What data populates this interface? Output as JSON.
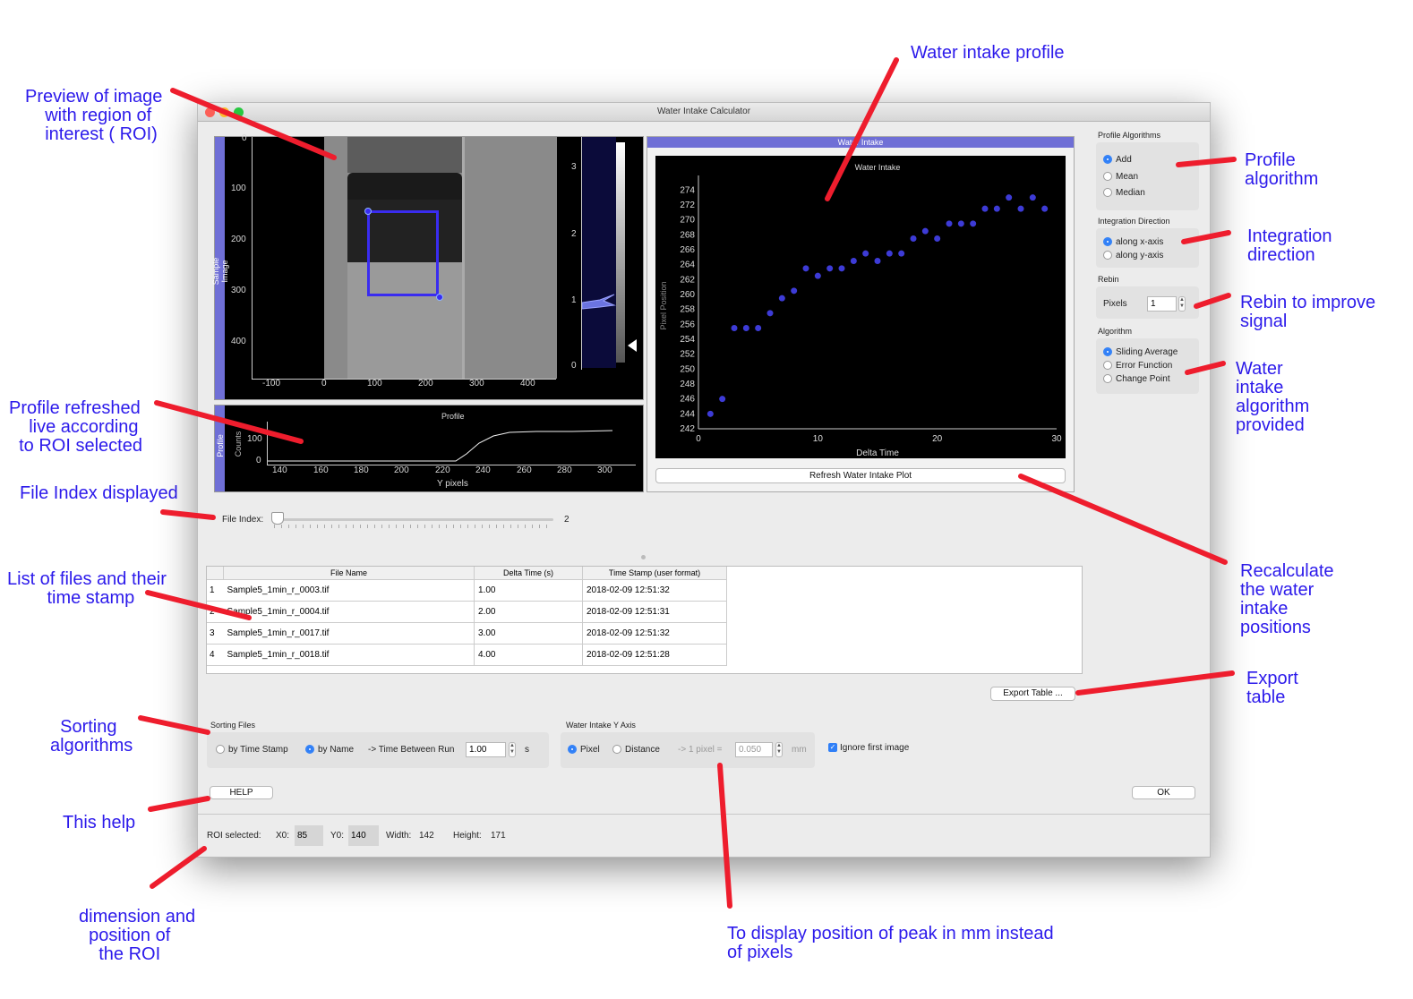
{
  "window": {
    "title": "Water Intake Calculator"
  },
  "annotations": {
    "preview": "Preview of image\n    with region of\n    interest ( ROI)",
    "profile_refreshed": "Profile refreshed\n    live according\n  to ROI selected",
    "file_index": "File Index displayed",
    "list_files": "List of files and their\n        time stamp",
    "sorting": "  Sorting\nalgorithms",
    "this_help": "This help",
    "dimension": "dimension and\n  position of\n    the ROI",
    "water_profile": "Water intake profile",
    "profile_algorithm": "Profile\nalgorithm",
    "integration_direction": "Integration\ndirection",
    "rebin": "Rebin to improve\nsignal",
    "water_algo": "Water\nintake\nalgorithm\nprovided",
    "recalculate": "Recalculate\nthe water\nintake\npositions",
    "export": "Export\ntable",
    "display_mm": "To display position of peak in mm instead\nof pixels"
  },
  "image_preview": {
    "side_label": "Sample Image",
    "y_ticks": [
      "0",
      "100",
      "200",
      "300",
      "400"
    ],
    "x_ticks": [
      "-100",
      "0",
      "100",
      "200",
      "300",
      "400"
    ],
    "hist_ticks": [
      "3",
      "2",
      "1",
      "0"
    ]
  },
  "profile_plot": {
    "side_label": "Profile",
    "title": "Profile",
    "ylabel": "Counts",
    "xlabel": "Y pixels",
    "y_ticks": [
      "100",
      "0"
    ],
    "x_ticks": [
      "140",
      "160",
      "180",
      "200",
      "220",
      "240",
      "260",
      "280",
      "300"
    ]
  },
  "water_intake_panel": {
    "header": "Water Intake",
    "refresh_button": "Refresh Water Intake Plot"
  },
  "chart_data": {
    "type": "scatter",
    "title": "Water Intake",
    "xlabel": "Delta Time",
    "ylabel": "Pixel Position",
    "xlim": [
      0,
      30
    ],
    "ylim": [
      242,
      275
    ],
    "x_ticks": [
      "0",
      "10",
      "20",
      "30"
    ],
    "y_ticks": [
      "242",
      "244",
      "246",
      "248",
      "250",
      "252",
      "254",
      "256",
      "258",
      "260",
      "262",
      "264",
      "266",
      "268",
      "270",
      "272",
      "274"
    ],
    "x": [
      1,
      2,
      3,
      4,
      5,
      6,
      7,
      8,
      9,
      10,
      11,
      12,
      13,
      14,
      15,
      16,
      17,
      18,
      19,
      20,
      21,
      22,
      23,
      24,
      25,
      26,
      27,
      28,
      29
    ],
    "y": [
      244,
      246,
      255.5,
      255.5,
      255.5,
      257.5,
      259.5,
      260.5,
      263.5,
      262.5,
      263.5,
      263.5,
      264.5,
      265.5,
      264.5,
      265.5,
      265.5,
      267.5,
      268.5,
      267.5,
      269.5,
      269.5,
      269.5,
      271.5,
      271.5,
      273,
      271.5,
      273,
      271.5
    ]
  },
  "right_panel": {
    "profile_algorithms": {
      "title": "Profile Algorithms",
      "options": [
        "Add",
        "Mean",
        "Median"
      ],
      "selected": "Add"
    },
    "integration_direction": {
      "title": "Integration Direction",
      "options": [
        "along x-axis",
        "along y-axis"
      ],
      "selected": "along x-axis"
    },
    "rebin": {
      "title": "Rebin",
      "label": "Pixels",
      "value": "1"
    },
    "algorithm": {
      "title": "Algorithm",
      "options": [
        "Sliding Average",
        "Error Function",
        "Change Point"
      ],
      "selected": "Sliding Average"
    }
  },
  "file_index": {
    "label": "File Index:",
    "value": "2"
  },
  "table": {
    "headers": [
      "File Name",
      "Delta Time (s)",
      "Time Stamp (user format)"
    ],
    "rows": [
      {
        "num": "1",
        "file": "Sample5_1min_r_0003.tif",
        "delta": "1.00",
        "stamp": "2018-02-09 12:51:32"
      },
      {
        "num": "2",
        "file": "Sample5_1min_r_0004.tif",
        "delta": "2.00",
        "stamp": "2018-02-09 12:51:31"
      },
      {
        "num": "3",
        "file": "Sample5_1min_r_0017.tif",
        "delta": "3.00",
        "stamp": "2018-02-09 12:51:32"
      },
      {
        "num": "4",
        "file": "Sample5_1min_r_0018.tif",
        "delta": "4.00",
        "stamp": "2018-02-09 12:51:28"
      }
    ]
  },
  "export_button": "Export Table ...",
  "sorting": {
    "title": "Sorting Files",
    "by_time": "by Time Stamp",
    "by_name": "by Name",
    "time_between_label": "-> Time Between Run",
    "time_between_value": "1.00",
    "unit": "s"
  },
  "yaxis": {
    "title": "Water Intake Y Axis",
    "pixel": "Pixel",
    "distance": "Distance",
    "conv_label": "-> 1 pixel =",
    "conv_value": "0.050",
    "unit": "mm"
  },
  "ignore_first": "Ignore first image",
  "help_button": "HELP",
  "ok_button": "OK",
  "status": {
    "roi_label": "ROI selected:",
    "x0_label": "X0:",
    "x0": "85",
    "y0_label": "Y0:",
    "y0": "140",
    "width_label": "Width:",
    "width": "142",
    "height_label": "Height:",
    "height": "171"
  }
}
